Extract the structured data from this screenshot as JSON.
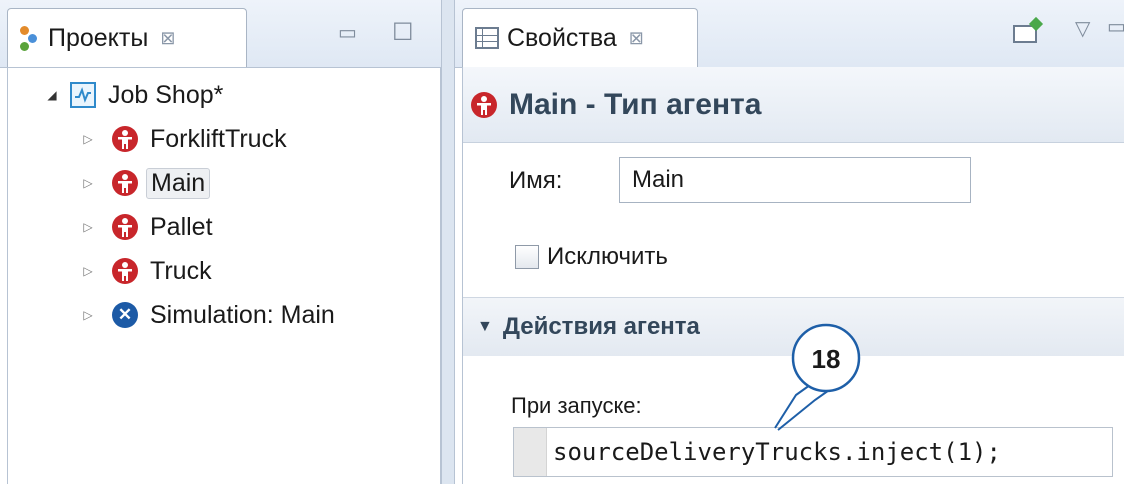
{
  "projects": {
    "tab_label": "Проекты",
    "close_glyph": "⊠",
    "tree": {
      "root": {
        "label": "Job Shop*"
      },
      "items": [
        {
          "label": "ForkliftTruck",
          "type": "agent"
        },
        {
          "label": "Main",
          "type": "agent",
          "selected": true
        },
        {
          "label": "Pallet",
          "type": "agent"
        },
        {
          "label": "Truck",
          "type": "agent"
        },
        {
          "label": "Simulation: Main",
          "type": "simulation"
        }
      ]
    }
  },
  "properties": {
    "tab_label": "Свойства",
    "close_glyph": "⊠",
    "title": "Main - Тип агента",
    "name_label": "Имя:",
    "name_value": "Main",
    "exclude_label": "Исключить",
    "section_title": "Действия агента",
    "on_startup_label": "При запуске:",
    "on_startup_code": "sourceDeliveryTrucks.inject(1);"
  },
  "callout": {
    "number": "18"
  },
  "colors": {
    "agent_icon": "#c8262b",
    "simulation_icon": "#1c5aa6",
    "model_icon": "#2f8acb",
    "callout": "#1e5fa8",
    "section_text": "#33475b"
  },
  "icons": {
    "projects_tab": "projects-tree-icon",
    "properties_tab": "properties-table-icon",
    "agent": "agent-person-icon",
    "simulation": "simulation-x-icon",
    "model": "model-chart-icon"
  }
}
